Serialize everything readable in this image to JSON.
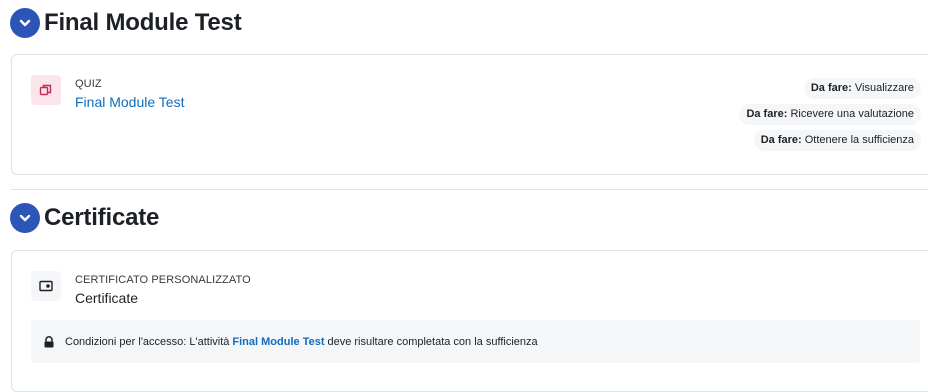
{
  "sections": [
    {
      "title": "Final Module Test",
      "activity": {
        "type_label": "QUIZ",
        "name": "Final Module Test",
        "icon": "quiz-icon",
        "completion": [
          {
            "prefix": "Da fare:",
            "text": "Visualizzare"
          },
          {
            "prefix": "Da fare:",
            "text": "Ricevere una valutazione"
          },
          {
            "prefix": "Da fare:",
            "text": "Ottenere la sufficienza"
          }
        ]
      }
    },
    {
      "title": "Certificate",
      "activity": {
        "type_label": "CERTIFICATO PERSONALIZZATO",
        "name": "Certificate",
        "icon": "certificate-icon",
        "restriction": {
          "before": "Condizioni per l'accesso: L'attività",
          "link": "Final Module Test",
          "after": "deve risultare completata con la sufficienza"
        }
      }
    }
  ],
  "colors": {
    "toggle": "#2c55b8",
    "link": "#0f6cbf",
    "quiz_icon_bg": "#fbe5ea",
    "quiz_icon_fg": "#c6275a"
  }
}
